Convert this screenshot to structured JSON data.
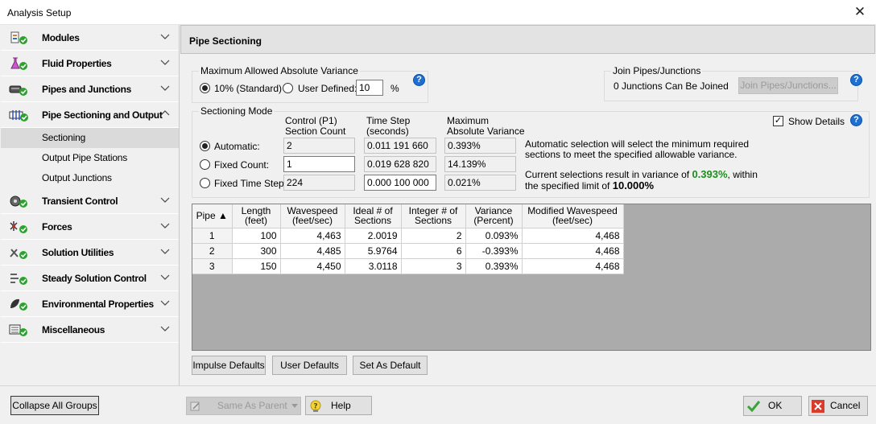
{
  "window": {
    "title": "Analysis Setup",
    "close_glyph": "✕"
  },
  "sidebar": {
    "groups": [
      {
        "label": "Modules",
        "icon": "modules-icon"
      },
      {
        "label": "Fluid Properties",
        "icon": "flask-icon"
      },
      {
        "label": "Pipes and Junctions",
        "icon": "pipe-icon"
      },
      {
        "label": "Pipe Sectioning and Output",
        "icon": "pipe-sectioning-icon",
        "expanded": true,
        "items": [
          "Sectioning",
          "Output Pipe Stations",
          "Output Junctions"
        ],
        "selected": "Sectioning"
      },
      {
        "label": "Transient Control",
        "icon": "transient-icon"
      },
      {
        "label": "Forces",
        "icon": "forces-icon"
      },
      {
        "label": "Solution Utilities",
        "icon": "tools-icon"
      },
      {
        "label": "Steady Solution Control",
        "icon": "steady-icon"
      },
      {
        "label": "Environmental Properties",
        "icon": "environment-icon"
      },
      {
        "label": "Miscellaneous",
        "icon": "misc-icon"
      }
    ]
  },
  "panel": {
    "title": "Pipe Sectioning",
    "variance": {
      "legend": "Maximum Allowed Absolute Variance",
      "standard_label": "10% (Standard)",
      "user_label": "User Defined:",
      "user_value": "10",
      "unit": "%",
      "selected": "standard"
    },
    "join": {
      "legend": "Join Pipes/Junctions",
      "status": "0 Junctions Can Be Joined",
      "button": "Join Pipes/Junctions..."
    },
    "mode": {
      "legend": "Sectioning Mode",
      "col_count": [
        "Control (P1)",
        "Section Count"
      ],
      "col_time": [
        "Time Step",
        "(seconds)"
      ],
      "col_var": [
        "Maximum",
        "Absolute Variance"
      ],
      "rows": [
        {
          "label": "Automatic:",
          "count": "2",
          "time": "0.011 191 660",
          "variance": "0.393%",
          "selected": true,
          "editable": false
        },
        {
          "label": "Fixed Count:",
          "count": "1",
          "time": "0.019 628 820",
          "variance": "14.139%",
          "selected": false,
          "editable": true
        },
        {
          "label": "Fixed Time Step:",
          "count": "224",
          "time": "0.000 100 000",
          "variance": "0.021%",
          "selected": false,
          "editable": false
        }
      ],
      "show_details": "Show Details",
      "show_details_checked": true,
      "info_line1": "Automatic selection will select the minimum required",
      "info_line2": "sections to meet the specified allowable variance.",
      "result_prefix": "Current selections result in variance of",
      "result_value": "0.393%",
      "result_mid": ", within",
      "result_line2_prefix": "the specified limit of",
      "result_limit": "10.000%",
      "result_color": "#1a8f1a"
    },
    "table": {
      "headers": [
        "Pipe",
        "Length (feet)",
        "Wavespeed (feet/sec)",
        "Ideal # of Sections",
        "Integer # of Sections",
        "Variance (Percent)",
        "Modified Wavespeed (feet/sec)"
      ],
      "header_lines": [
        [
          "Pipe ▲"
        ],
        [
          "Length",
          "(feet)"
        ],
        [
          "Wavespeed",
          "(feet/sec)"
        ],
        [
          "Ideal # of",
          "Sections"
        ],
        [
          "Integer # of",
          "Sections"
        ],
        [
          "Variance",
          "(Percent)"
        ],
        [
          "Modified Wavespeed",
          "(feet/sec)"
        ]
      ],
      "rows": [
        [
          "1",
          "100",
          "4,463",
          "2.0019",
          "2",
          "0.093%",
          "4,468"
        ],
        [
          "2",
          "300",
          "4,485",
          "5.9764",
          "6",
          "-0.393%",
          "4,468"
        ],
        [
          "3",
          "150",
          "4,450",
          "3.0118",
          "3",
          "0.393%",
          "4,468"
        ]
      ]
    },
    "buttons": {
      "impulse": "Impulse Defaults",
      "user": "User Defaults",
      "set": "Set As Default"
    }
  },
  "footer": {
    "collapse": "Collapse All Groups",
    "same_as_parent": "Same As Parent",
    "help": "Help",
    "ok": "OK",
    "cancel": "Cancel"
  }
}
